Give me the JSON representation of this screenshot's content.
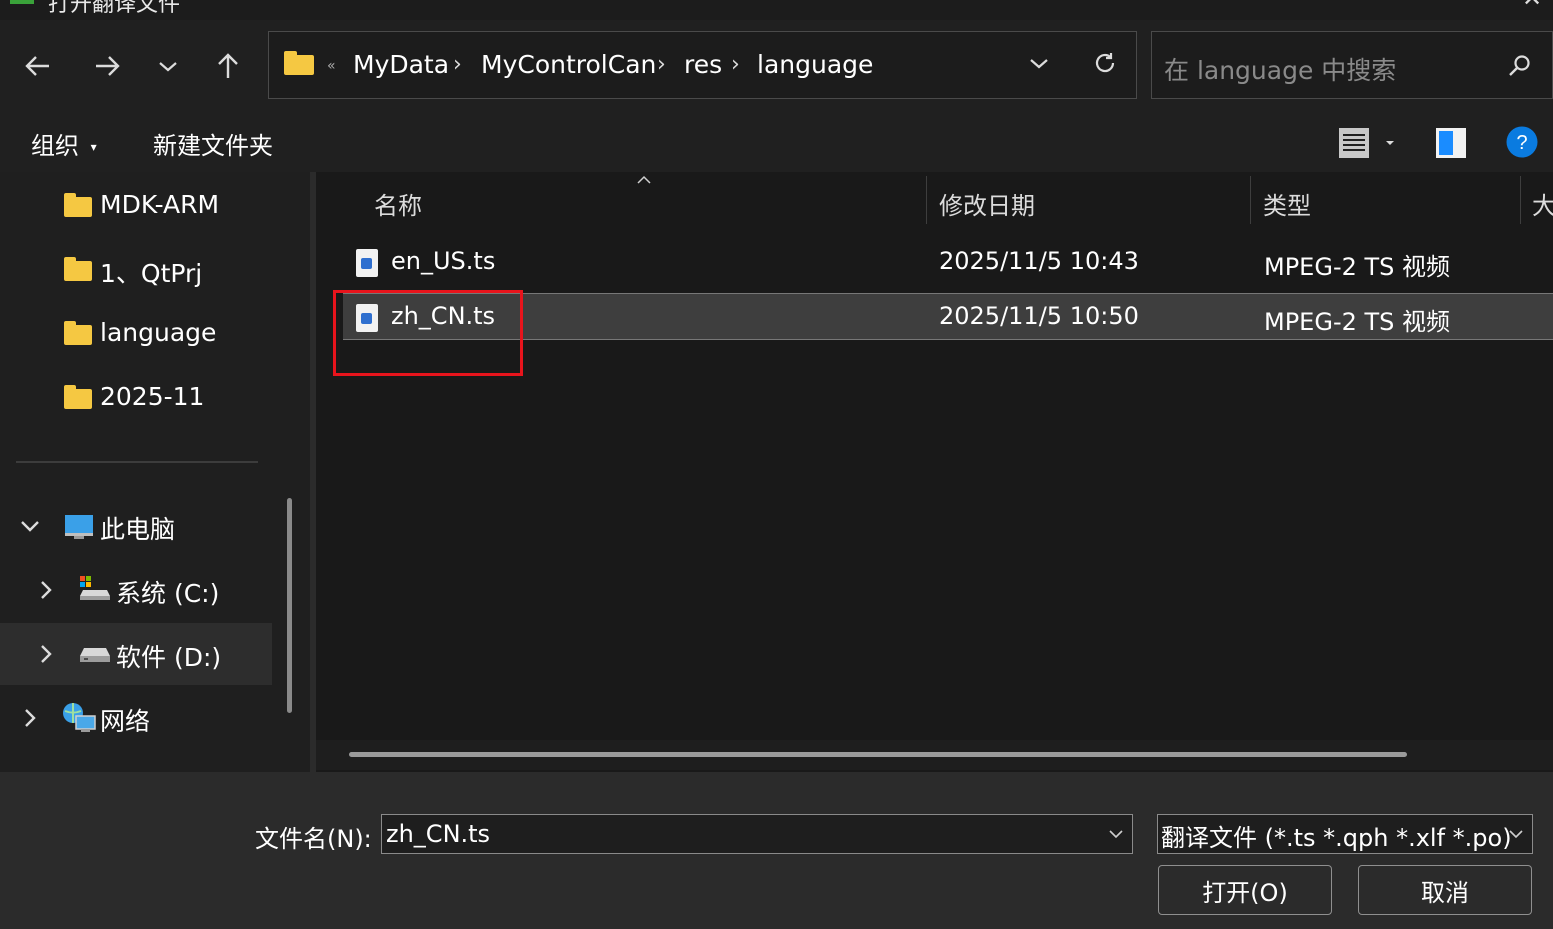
{
  "window": {
    "title": "打开翻译文件"
  },
  "nav": {
    "back_icon": "arrow-left-icon",
    "forward_icon": "arrow-right-icon",
    "recent_icon": "chevron-down-icon",
    "up_icon": "arrow-up-icon"
  },
  "address": {
    "overflow": "«",
    "crumbs": [
      "MyData",
      "MyControlCan",
      "res",
      "language"
    ],
    "separator": "›"
  },
  "search": {
    "placeholder": "在 language 中搜索"
  },
  "commandbar": {
    "organize": "组织",
    "new_folder": "新建文件夹"
  },
  "sidebar": {
    "folders": [
      "MDK-ARM",
      "1、QtPrj",
      "language",
      "2025-11"
    ],
    "this_pc": "此电脑",
    "drives": [
      "系统 (C:)",
      "软件 (D:)"
    ],
    "network": "网络"
  },
  "columns": {
    "name": "名称",
    "modified": "修改日期",
    "type": "类型",
    "size": "大"
  },
  "files": [
    {
      "name": "en_US.ts",
      "modified": "2025/11/5 10:43",
      "type": "MPEG-2 TS 视频"
    },
    {
      "name": "zh_CN.ts",
      "modified": "2025/11/5 10:50",
      "type": "MPEG-2 TS 视频"
    }
  ],
  "bottom": {
    "filename_label": "文件名(N):",
    "filename_value": "zh_CN.ts",
    "filter_value": "翻译文件 (*.ts *.qph *.xlf *.po)",
    "open_label": "打开(O)",
    "cancel_label": "取消"
  },
  "colors": {
    "accent": "#0078d4",
    "highlight": "#e8141c",
    "folder": "#f5c842"
  }
}
